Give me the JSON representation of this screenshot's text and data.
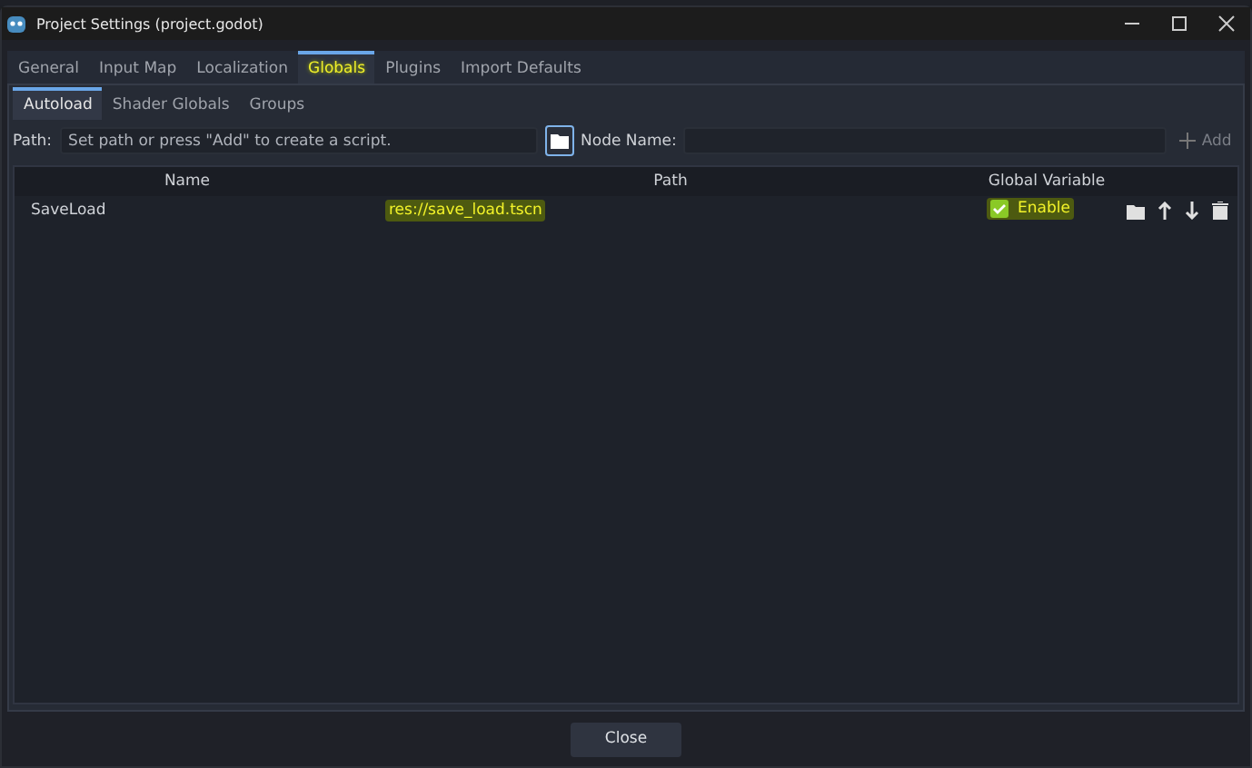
{
  "window": {
    "title": "Project Settings (project.godot)"
  },
  "tabs": [
    {
      "label": "General",
      "selected": false,
      "highlighted": false
    },
    {
      "label": "Input Map",
      "selected": false,
      "highlighted": false
    },
    {
      "label": "Localization",
      "selected": false,
      "highlighted": false
    },
    {
      "label": "Globals",
      "selected": true,
      "highlighted": true
    },
    {
      "label": "Plugins",
      "selected": false,
      "highlighted": false
    },
    {
      "label": "Import Defaults",
      "selected": false,
      "highlighted": false
    }
  ],
  "subtabs": [
    {
      "label": "Autoload",
      "selected": true
    },
    {
      "label": "Shader Globals",
      "selected": false
    },
    {
      "label": "Groups",
      "selected": false
    }
  ],
  "path_row": {
    "path_label": "Path:",
    "path_placeholder": "Set path or press \"Add\" to create a script.",
    "node_label": "Node Name:",
    "add_button": "Add"
  },
  "table": {
    "columns": [
      "Name",
      "Path",
      "Global Variable"
    ],
    "rows": [
      {
        "name": "SaveLoad",
        "path": "res://save_load.tscn",
        "path_highlighted": true,
        "enabled": true,
        "enable_label": "Enable",
        "enable_highlighted": true
      }
    ]
  },
  "close_button": "Close"
}
